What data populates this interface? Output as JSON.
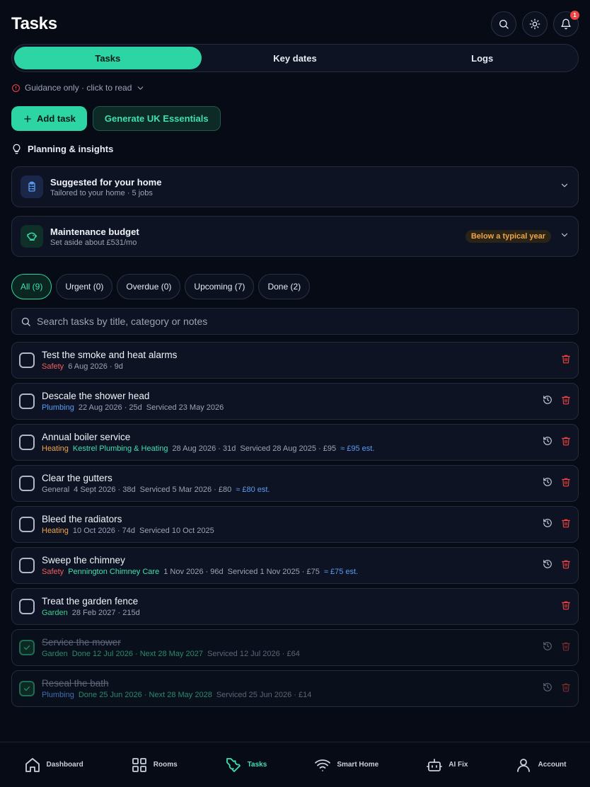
{
  "header": {
    "title": "Tasks",
    "notification_count": "1",
    "icons": [
      "search-icon",
      "sun-icon",
      "bell-icon"
    ]
  },
  "tabs": [
    {
      "label": "Tasks",
      "active": true
    },
    {
      "label": "Key dates",
      "active": false
    },
    {
      "label": "Logs",
      "active": false
    }
  ],
  "guidance": {
    "text": "Guidance only · click to read"
  },
  "actions": {
    "add_label": "Add task",
    "generate_label": "Generate UK Essentials"
  },
  "insights": {
    "title": "Planning & insights",
    "cards": [
      {
        "title": "Suggested for your home",
        "subtitle": "Tailored to your home · 5 jobs",
        "icon": "clipboard-icon"
      },
      {
        "title": "Maintenance budget",
        "subtitle": "Set aside about £531/mo",
        "badge": "Below a typical year",
        "icon": "piggy-bank-icon"
      }
    ]
  },
  "filters": [
    {
      "label": "All (9)",
      "active": true
    },
    {
      "label": "Urgent (0)",
      "active": false
    },
    {
      "label": "Overdue (0)",
      "active": false
    },
    {
      "label": "Upcoming (7)",
      "active": false
    },
    {
      "label": "Done (2)",
      "active": false
    }
  ],
  "search": {
    "placeholder": "Search tasks by title, category or notes",
    "value": ""
  },
  "tasks": [
    {
      "title": "Test the smoke and heat alarms",
      "category": "Safety",
      "contractor": "",
      "due": "6 Aug 2026 · 9d",
      "serviced": "",
      "estimate": "",
      "done": false
    },
    {
      "title": "Descale the shower head",
      "category": "Plumbing",
      "contractor": "",
      "due": "22 Aug 2026 · 25d",
      "serviced": "Serviced 23 May 2026",
      "estimate": "",
      "done": false
    },
    {
      "title": "Annual boiler service",
      "category": "Heating",
      "contractor": "Kestrel Plumbing & Heating",
      "due": "28 Aug 2026 · 31d",
      "serviced": "Serviced 28 Aug 2025 · £95",
      "estimate": "≈ £95 est.",
      "done": false
    },
    {
      "title": "Clear the gutters",
      "category": "General",
      "contractor": "",
      "due": "4 Sept 2026 · 38d",
      "serviced": "Serviced 5 Mar 2026 · £80",
      "estimate": "≈ £80 est.",
      "done": false
    },
    {
      "title": "Bleed the radiators",
      "category": "Heating",
      "contractor": "",
      "due": "10 Oct 2026 · 74d",
      "serviced": "Serviced 10 Oct 2025",
      "estimate": "",
      "done": false
    },
    {
      "title": "Sweep the chimney",
      "category": "Safety",
      "contractor": "Pennington Chimney Care",
      "due": "1 Nov 2026 · 96d",
      "serviced": "Serviced 1 Nov 2025 · £75",
      "estimate": "≈ £75 est.",
      "done": false
    },
    {
      "title": "Treat the garden fence",
      "category": "Garden",
      "contractor": "",
      "due": "28 Feb 2027 · 215d",
      "serviced": "",
      "estimate": "",
      "done": false
    },
    {
      "title": "Service the mower",
      "category": "Garden",
      "contractor": "",
      "due": "Done 12 Jul 2026 · Next 28 May 2027",
      "serviced": "Serviced 12 Jul 2026 · £64",
      "estimate": "",
      "done": true
    },
    {
      "title": "Reseal the bath",
      "category": "Plumbing",
      "contractor": "",
      "due": "Done 25 Jun 2026 · Next 28 May 2028",
      "serviced": "Serviced 25 Jun 2026 · £14",
      "estimate": "",
      "done": true
    }
  ],
  "bottom_nav": [
    {
      "label": "Dashboard",
      "icon": "home-icon",
      "active": false
    },
    {
      "label": "Rooms",
      "icon": "grid-icon",
      "active": false
    },
    {
      "label": "Tasks",
      "icon": "wrench-icon",
      "active": true
    },
    {
      "label": "Smart Home",
      "icon": "wifi-icon",
      "active": false
    },
    {
      "label": "AI Fix",
      "icon": "robot-icon",
      "active": false
    },
    {
      "label": "Account",
      "icon": "user-icon",
      "active": false
    }
  ],
  "colors": {
    "background": "#070b16",
    "accent": "#2dd4a4",
    "safety": "#f05d5d",
    "plumbing": "#5b9cf5",
    "heating": "#f0a545",
    "garden": "#3ccf8e",
    "badge": "#f0a545"
  }
}
